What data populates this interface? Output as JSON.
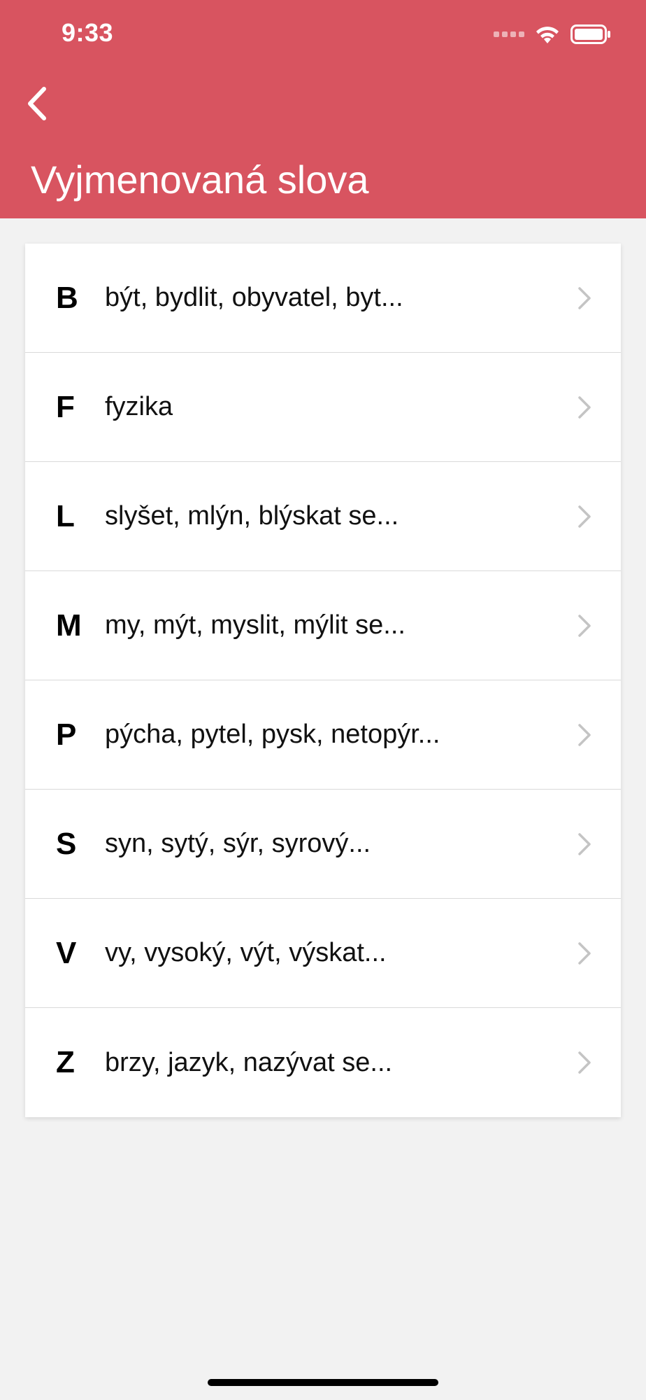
{
  "status_bar": {
    "time": "9:33"
  },
  "header": {
    "title": "Vyjmenovaná slova",
    "back_icon": "chevron-left-icon"
  },
  "colors": {
    "header_background": "#d85460",
    "page_background": "#f2f2f2",
    "card_background": "#ffffff",
    "chevron": "#c4c4c4"
  },
  "list": {
    "items": [
      {
        "letter": "B",
        "words": "být, bydlit, obyvatel, byt..."
      },
      {
        "letter": "F",
        "words": "fyzika"
      },
      {
        "letter": "L",
        "words": "slyšet, mlýn, blýskat se..."
      },
      {
        "letter": "M",
        "words": "my, mýt, myslit, mýlit se..."
      },
      {
        "letter": "P",
        "words": "pýcha, pytel, pysk, netopýr..."
      },
      {
        "letter": "S",
        "words": "syn, sytý, sýr, syrový..."
      },
      {
        "letter": "V",
        "words": "vy, vysoký, výt, výskat..."
      },
      {
        "letter": "Z",
        "words": "brzy, jazyk, nazývat se..."
      }
    ]
  }
}
